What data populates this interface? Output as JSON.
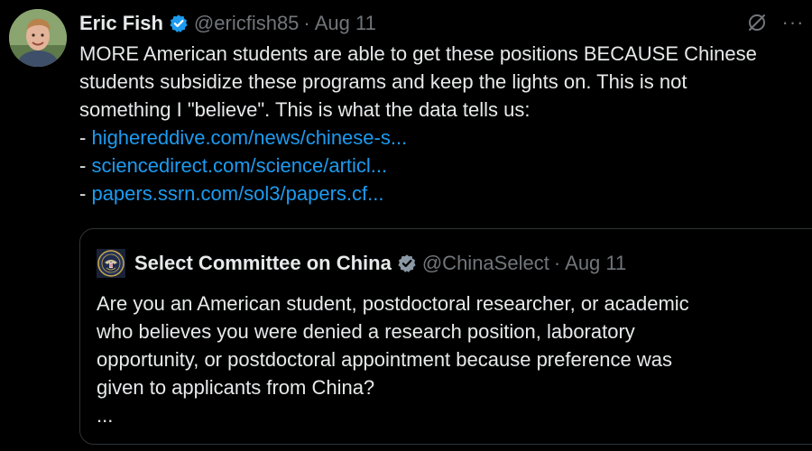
{
  "tweet": {
    "author": {
      "name": "Eric Fish",
      "handle": "@ericfish85",
      "separator": "·",
      "date": "Aug 11",
      "avatar_icon": "user-photo-avatar"
    },
    "text_lines": [
      "MORE American students are able to get these positions BECAUSE Chinese",
      "students subsidize these programs and keep the lights on. This is not",
      "something I \"believe\". This is what the data tells us:"
    ],
    "links": [
      {
        "prefix": "- ",
        "text": "highereddive.com/news/chinese-s..."
      },
      {
        "prefix": "- ",
        "text": "sciencedirect.com/science/articl..."
      },
      {
        "prefix": "- ",
        "text": "papers.ssrn.com/sol3/papers.cf..."
      }
    ],
    "more_label": "···"
  },
  "quote": {
    "author": {
      "name": "Select Committee on China",
      "handle": "@ChinaSelect",
      "separator": "·",
      "date": "Aug 11",
      "avatar_icon": "congressional-seal-avatar"
    },
    "text_lines": [
      "Are you an American student, postdoctoral researcher, or academic",
      "who believes you were denied a research position, laboratory",
      "opportunity, or postdoctoral appointment because preference was",
      "given to applicants from China?",
      "..."
    ]
  },
  "colors": {
    "background": "#000000",
    "text": "#e7e9ea",
    "muted": "#71767b",
    "link": "#1d9bf0",
    "verified": "#1d9bf0",
    "border": "#2f3336"
  }
}
